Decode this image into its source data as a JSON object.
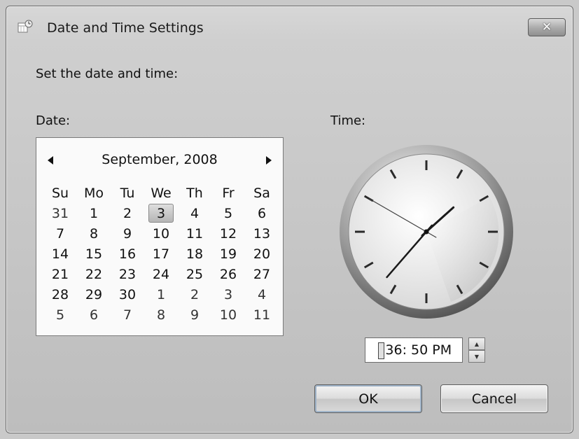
{
  "window": {
    "title": "Date and Time Settings",
    "close_glyph": "✕"
  },
  "prompt": "Set the date and time:",
  "date_label": "Date:",
  "time_label": "Time:",
  "calendar": {
    "month_year": "September, 2008",
    "prev_glyph": "◀",
    "next_glyph": "▶",
    "weekdays": [
      "Su",
      "Mo",
      "Tu",
      "We",
      "Th",
      "Fr",
      "Sa"
    ],
    "weeks": [
      [
        "31",
        "1",
        "2",
        "3",
        "4",
        "5",
        "6"
      ],
      [
        "7",
        "8",
        "9",
        "10",
        "11",
        "12",
        "13"
      ],
      [
        "14",
        "15",
        "16",
        "17",
        "18",
        "19",
        "20"
      ],
      [
        "21",
        "22",
        "23",
        "24",
        "25",
        "26",
        "27"
      ],
      [
        "28",
        "29",
        "30",
        "1",
        "2",
        "3",
        "4"
      ],
      [
        "5",
        "6",
        "7",
        "8",
        "9",
        "10",
        "11"
      ]
    ],
    "selected_day": "3"
  },
  "clock": {
    "hour": 1,
    "minute": 36,
    "second": 50
  },
  "time_field": {
    "value": ":36: 50 PM",
    "up_glyph": "▲",
    "down_glyph": "▼"
  },
  "buttons": {
    "ok": "OK",
    "cancel": "Cancel"
  },
  "icons": {
    "title": "date-time-icon",
    "close": "close-icon"
  }
}
